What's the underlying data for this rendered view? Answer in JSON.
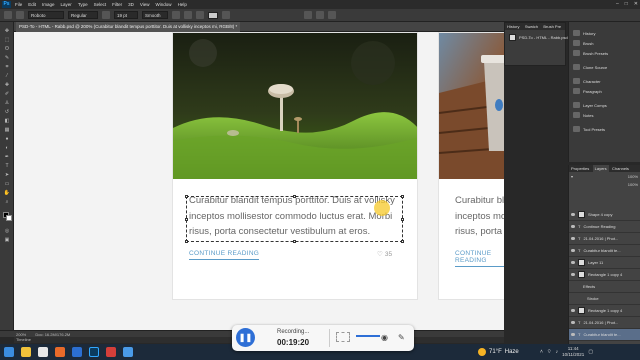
{
  "app": {
    "logo": "Ps"
  },
  "menu": [
    "File",
    "Edit",
    "Image",
    "Layer",
    "Type",
    "Select",
    "Filter",
    "3D",
    "View",
    "Window",
    "Help"
  ],
  "window_controls": [
    "–",
    "□",
    "✕"
  ],
  "options_bar": {
    "font_family": "Roboto",
    "font_style": "Regular",
    "font_size": "19 pt",
    "aa_mode": "Smooth"
  },
  "document_tab": "PSD-To - HTML - Rabb.psd @ 200% (Curabitur blandit tempus porttitor. Duis at vollisky inceptos mi, RGB/8) *",
  "cards": [
    {
      "text": "Curabitur blandit tempus porttitor. Duis at vollisky inceptos mollisestor commodo luctus erat. Morbi risus, porta consectetur vestibulum at eros.",
      "link": "CONTINUE READING",
      "likes": "35",
      "heart_icon": "heart-icon"
    },
    {
      "text": "Curabitur blandit tempus porttitor. Duis at vollisky inceptos mollisestor commodo luctus erat. Morbi risus, porta consectetur vestibulum at eros.",
      "link": "CONTINUE READING"
    }
  ],
  "status_bar": {
    "zoom": "200%",
    "doc_size": "Doc: 16.2M/176.2M"
  },
  "timeline_tab": "Timeline",
  "history_panel": {
    "tabs": [
      "History",
      "Swatch",
      "Brush Pre"
    ],
    "snapshot": "PSD-To - HTML - Rabb.psd"
  },
  "side_panel_items": [
    "History",
    "Brush",
    "Brush Presets",
    "Clone Source",
    "Character",
    "Paragraph",
    "Layer Comps",
    "Notes",
    "Tool Presets"
  ],
  "layers_panel": {
    "tabs": [
      "Properties",
      "Layers",
      "Channels"
    ],
    "opacity": "100%",
    "fill": "100%",
    "layers": [
      "Shape 4 copy",
      "Continue Reading",
      "21.04.2016 | Phot...",
      "Curabitur blandit te...",
      "Layer 11",
      "Rectangle 1 copy 4",
      "Effects",
      "Stroke",
      "Rectangle 1 copy 4",
      "21.04.2016 | Phot...",
      "Pellentesque Maxx...",
      "Curabitur blandit te..."
    ]
  },
  "recorder": {
    "label": "Recording...",
    "time": "00:19:20"
  },
  "taskbar": {
    "weather_temp": "71°F",
    "weather_desc": "Haze",
    "time": "11:44",
    "date": "10/11/2021"
  },
  "colors": {
    "accent_link": "#5a9bc8",
    "recorder_button": "#2e6fd6",
    "taskbar": "#1c2a3a"
  }
}
